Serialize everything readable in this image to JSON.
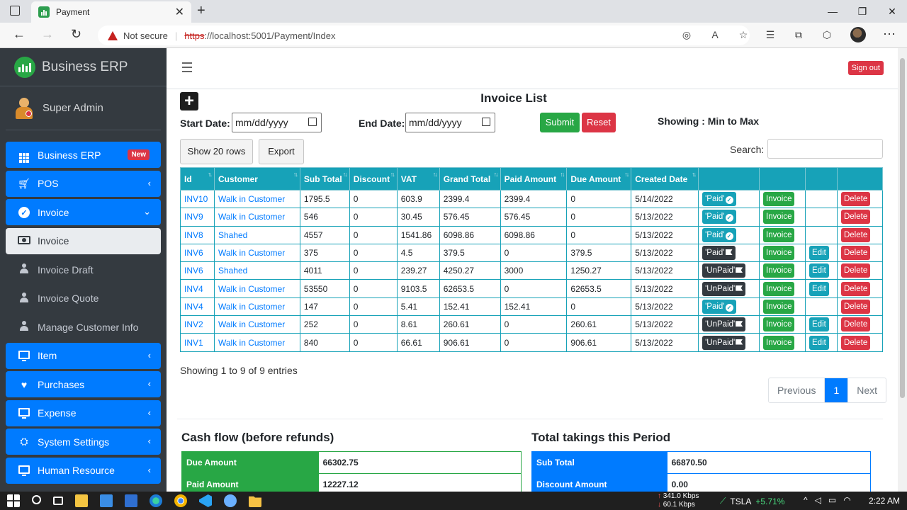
{
  "browser": {
    "tab_title": "Payment",
    "not_secure": "Not secure",
    "url_https": "https",
    "url_rest": "://localhost:5001/Payment/Index"
  },
  "sidebar": {
    "brand": "Business ERP",
    "user": "Super Admin",
    "items": [
      {
        "label": "Business ERP",
        "icon": "grid-icon",
        "style": "blue",
        "badge": "New"
      },
      {
        "label": "POS",
        "icon": "cart-icon",
        "style": "blue",
        "caret": "‹"
      },
      {
        "label": "Invoice",
        "icon": "check-circle-icon",
        "style": "blue",
        "caret": "⌄"
      },
      {
        "label": "Invoice",
        "icon": "money-icon",
        "style": "light"
      },
      {
        "label": "Invoice Draft",
        "icon": "user-icon",
        "style": "plain"
      },
      {
        "label": "Invoice Quote",
        "icon": "user-icon",
        "style": "plain"
      },
      {
        "label": "Manage Customer Info",
        "icon": "user-edit-icon",
        "style": "plain"
      },
      {
        "label": "Item",
        "icon": "laptop-icon",
        "style": "blue",
        "caret": "‹"
      },
      {
        "label": "Purchases",
        "icon": "heart-icon",
        "style": "blue",
        "caret": "‹"
      },
      {
        "label": "Expense",
        "icon": "monitor-icon",
        "style": "blue",
        "caret": "‹"
      },
      {
        "label": "System Settings",
        "icon": "briefcase-icon",
        "style": "blue",
        "caret": "‹"
      },
      {
        "label": "Human Resource",
        "icon": "monitor-icon",
        "style": "blue",
        "caret": "‹"
      }
    ]
  },
  "header": {
    "signout": "Sign out"
  },
  "page": {
    "title": "Invoice List",
    "start_label": "Start Date:",
    "end_label": "End Date:",
    "date_placeholder": "mm/dd/yyyy",
    "submit": "Submit",
    "reset": "Reset",
    "showing_range": "Showing : Min to Max",
    "show_rows": "Show 20 rows",
    "export": "Export",
    "search_label": "Search:"
  },
  "table": {
    "headers": [
      "Id",
      "Customer",
      "Sub Total",
      "Discount",
      "VAT",
      "Grand Total",
      "Paid Amount",
      "Due Amount",
      "Created Date",
      "",
      "",
      "",
      ""
    ],
    "rows": [
      {
        "id": "INV10",
        "customer": "Walk in Customer",
        "sub": "1795.5",
        "disc": "0",
        "vat": "603.9",
        "grand": "2399.4",
        "paid": "2399.4",
        "due": "0",
        "date": "5/14/2022",
        "status": "'Paid'",
        "status_style": "paid",
        "invoice": "Invoice",
        "edit": "",
        "delete": "Delete"
      },
      {
        "id": "INV9",
        "customer": "Walk in Customer",
        "sub": "546",
        "disc": "0",
        "vat": "30.45",
        "grand": "576.45",
        "paid": "576.45",
        "due": "0",
        "date": "5/13/2022",
        "status": "'Paid'",
        "status_style": "paid",
        "invoice": "Invoice",
        "edit": "",
        "delete": "Delete"
      },
      {
        "id": "INV8",
        "customer": "Shahed",
        "sub": "4557",
        "disc": "0",
        "vat": "1541.86",
        "grand": "6098.86",
        "paid": "6098.86",
        "due": "0",
        "date": "5/13/2022",
        "status": "'Paid'",
        "status_style": "paid",
        "invoice": "Invoice",
        "edit": "",
        "delete": "Delete"
      },
      {
        "id": "INV6",
        "customer": "Walk in Customer",
        "sub": "375",
        "disc": "0",
        "vat": "4.5",
        "grand": "379.5",
        "paid": "0",
        "due": "379.5",
        "date": "5/13/2022",
        "status": "'Paid'",
        "status_style": "dark",
        "invoice": "Invoice",
        "edit": "Edit",
        "delete": "Delete"
      },
      {
        "id": "INV6",
        "customer": "Shahed",
        "sub": "4011",
        "disc": "0",
        "vat": "239.27",
        "grand": "4250.27",
        "paid": "3000",
        "due": "1250.27",
        "date": "5/13/2022",
        "status": "'UnPaid'",
        "status_style": "dark",
        "invoice": "Invoice",
        "edit": "Edit",
        "delete": "Delete"
      },
      {
        "id": "INV4",
        "customer": "Walk in Customer",
        "sub": "53550",
        "disc": "0",
        "vat": "9103.5",
        "grand": "62653.5",
        "paid": "0",
        "due": "62653.5",
        "date": "5/13/2022",
        "status": "'UnPaid'",
        "status_style": "dark",
        "invoice": "Invoice",
        "edit": "Edit",
        "delete": "Delete"
      },
      {
        "id": "INV4",
        "customer": "Walk in Customer",
        "sub": "147",
        "disc": "0",
        "vat": "5.41",
        "grand": "152.41",
        "paid": "152.41",
        "due": "0",
        "date": "5/13/2022",
        "status": "'Paid'",
        "status_style": "paid",
        "invoice": "Invoice",
        "edit": "",
        "delete": "Delete"
      },
      {
        "id": "INV2",
        "customer": "Walk in Customer",
        "sub": "252",
        "disc": "0",
        "vat": "8.61",
        "grand": "260.61",
        "paid": "0",
        "due": "260.61",
        "date": "5/13/2022",
        "status": "'UnPaid'",
        "status_style": "dark",
        "invoice": "Invoice",
        "edit": "Edit",
        "delete": "Delete"
      },
      {
        "id": "INV1",
        "customer": "Walk in Customer",
        "sub": "840",
        "disc": "0",
        "vat": "66.61",
        "grand": "906.61",
        "paid": "0",
        "due": "906.61",
        "date": "5/13/2022",
        "status": "'UnPaid'",
        "status_style": "dark",
        "invoice": "Invoice",
        "edit": "Edit",
        "delete": "Delete"
      }
    ]
  },
  "footer": {
    "entries": "Showing 1 to 9 of 9 entries",
    "prev": "Previous",
    "page": "1",
    "next": "Next"
  },
  "cashflow": {
    "title": "Cash flow (before refunds)",
    "rows": [
      {
        "label": "Due Amount",
        "value": "66302.75"
      },
      {
        "label": "Paid Amount",
        "value": "12227.12"
      }
    ]
  },
  "takings": {
    "title": "Total takings this Period",
    "rows": [
      {
        "label": "Sub Total",
        "value": "66870.50"
      },
      {
        "label": "Discount Amount",
        "value": "0.00"
      }
    ]
  },
  "taskbar": {
    "net_up": "341.0 Kbps",
    "net_down": "60.1 Kbps",
    "ticker": "TSLA",
    "ticker_change": "+5.71%",
    "time": "2:22 AM"
  },
  "colors": {
    "primary": "#007bff",
    "info": "#17a2b8",
    "success": "#28a745",
    "danger": "#dc3545",
    "sidebar": "#343a40"
  }
}
